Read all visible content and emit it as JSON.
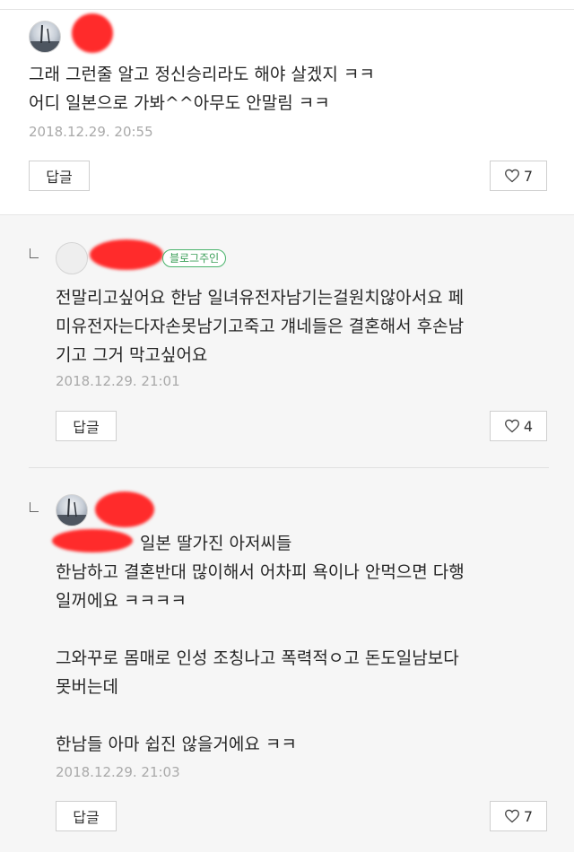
{
  "comments": [
    {
      "lines": [
        "그래 그런줄 알고 정신승리라도 해야 살겠지 ㅋㅋ",
        "어디 일본으로 가봐^^아무도 안말림 ㅋㅋ"
      ],
      "date": "2018.12.29. 20:55",
      "reply_label": "답글",
      "likes": "7"
    },
    {
      "badge": "블로그주인",
      "lines": [
        "전말리고싶어요 한남 일녀유전자남기는걸원치않아서요 페",
        "미유전자는다자손못남기고죽고 걔네들은 결혼해서 후손남",
        "기고 그거 막고싶어요"
      ],
      "date": "2018.12.29. 21:01",
      "reply_label": "답글",
      "likes": "4"
    },
    {
      "lines": [
        "일본 딸가진 아저씨들",
        "한남하고 결혼반대 많이해서 어차피 욕이나 안먹으면 다행",
        "일꺼에요 ㅋㅋㅋㅋ",
        "",
        "그와꾸로 몸매로 인성 조칭나고 폭력적ㅇ고 돈도일남보다",
        "못버는데",
        "",
        "한남들 아마 쉽진 않을거에요 ㅋㅋ"
      ],
      "date": "2018.12.29. 21:03",
      "reply_label": "답글",
      "likes": "7"
    }
  ],
  "colors": {
    "redaction": "#ff2b2b",
    "owner_badge": "#49b36b",
    "date": "#a9a9a9"
  },
  "icons": {
    "like": "heart-outline-icon",
    "reply_indent": "reply-arrow-icon"
  }
}
